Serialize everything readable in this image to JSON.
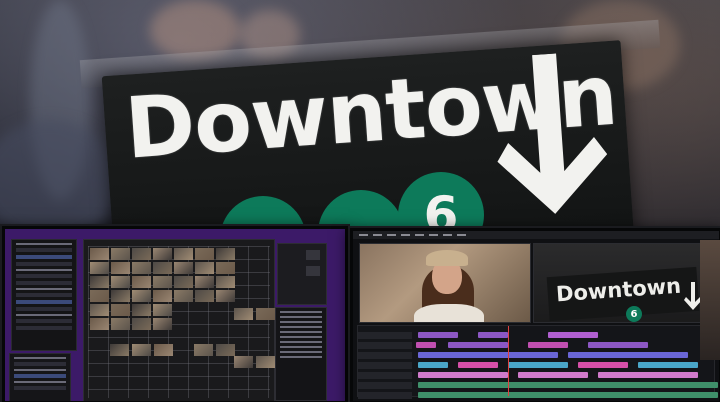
{
  "sign": {
    "text": "Downtown",
    "route_number": "6"
  },
  "viewer_sign": {
    "text": "Downtown",
    "route_number": "6"
  },
  "colors": {
    "sign_background": "#131515",
    "sign_text": "#f2f2ef",
    "route_green": "#0d7a5a",
    "left_monitor_background": "#3c1a68",
    "right_monitor_background": "#0f1013"
  },
  "icons": [
    "down-arrow-icon"
  ]
}
